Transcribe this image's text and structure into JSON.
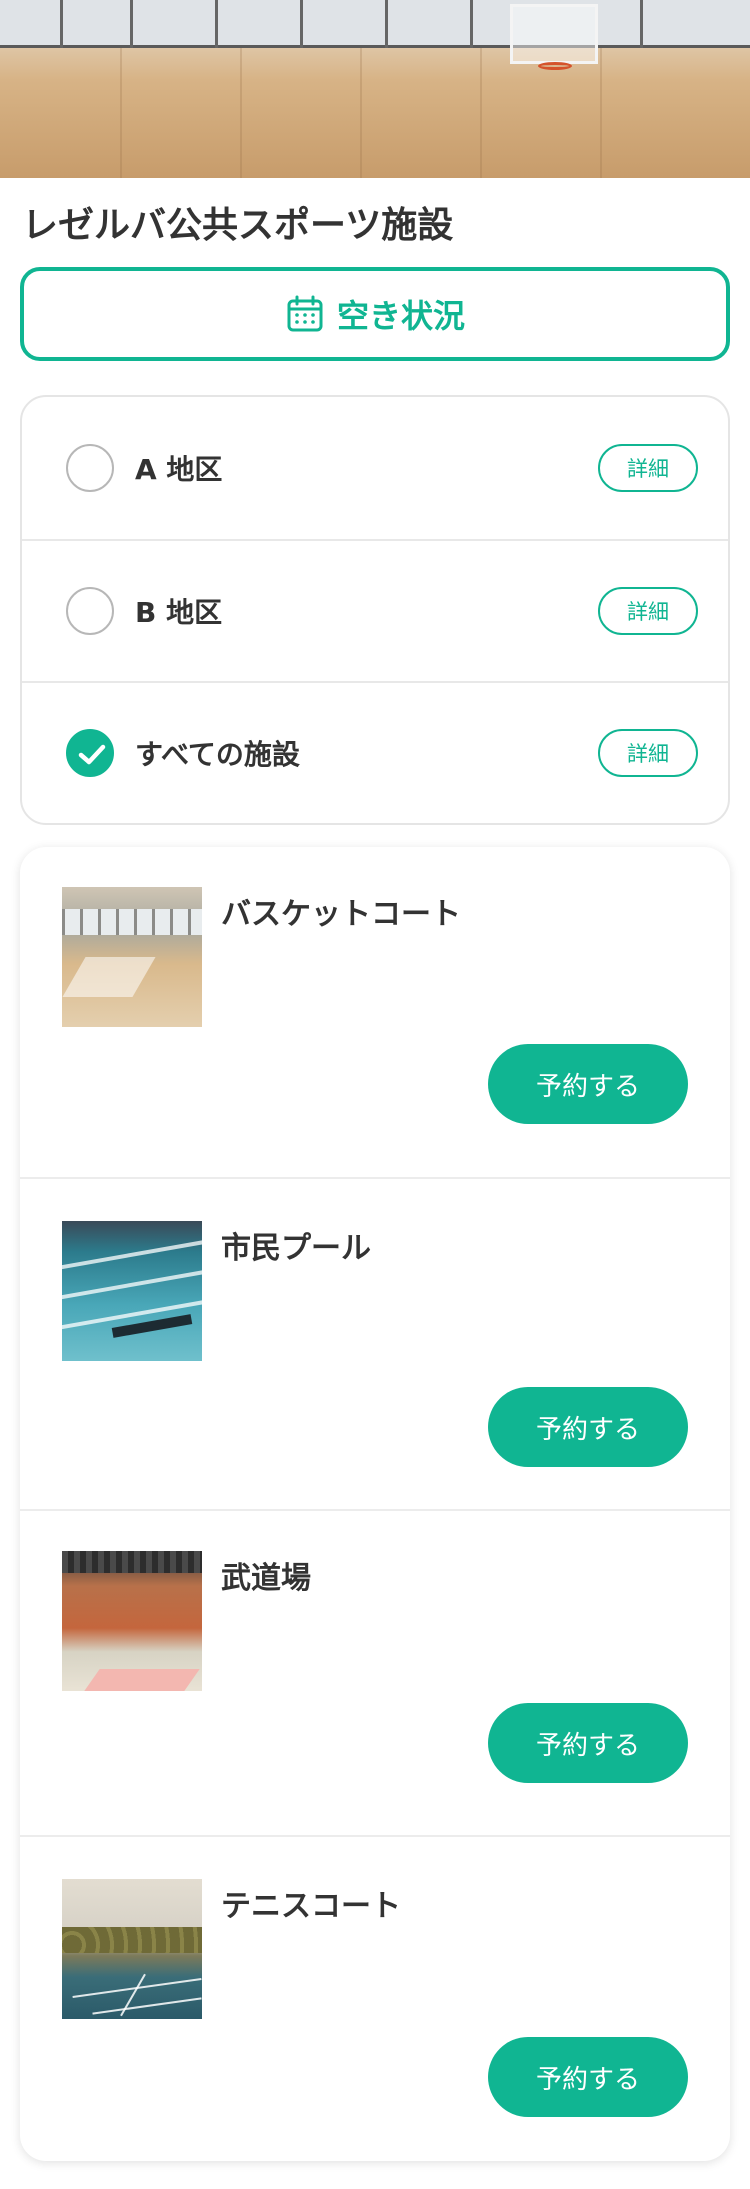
{
  "page": {
    "title": "レゼルバ公共スポーツ施設"
  },
  "availability_button": {
    "label": "空き状況",
    "icon": "calendar-icon"
  },
  "areas": [
    {
      "label": "A 地区",
      "detail_label": "詳細",
      "selected": false
    },
    {
      "label": "B 地区",
      "detail_label": "詳細",
      "selected": false
    },
    {
      "label": "すべての施設",
      "detail_label": "詳細",
      "selected": true
    }
  ],
  "facilities": [
    {
      "name": "バスケットコート",
      "reserve_label": "予約する",
      "image": "basketball-court-photo"
    },
    {
      "name": "市民プール",
      "reserve_label": "予約する",
      "image": "swimming-pool-photo"
    },
    {
      "name": "武道場",
      "reserve_label": "予約する",
      "image": "martial-arts-hall-photo"
    },
    {
      "name": "テニスコート",
      "reserve_label": "予約する",
      "image": "tennis-court-photo"
    }
  ],
  "colors": {
    "accent": "#10b592",
    "text": "#333333",
    "border": "#e5e5e5"
  }
}
